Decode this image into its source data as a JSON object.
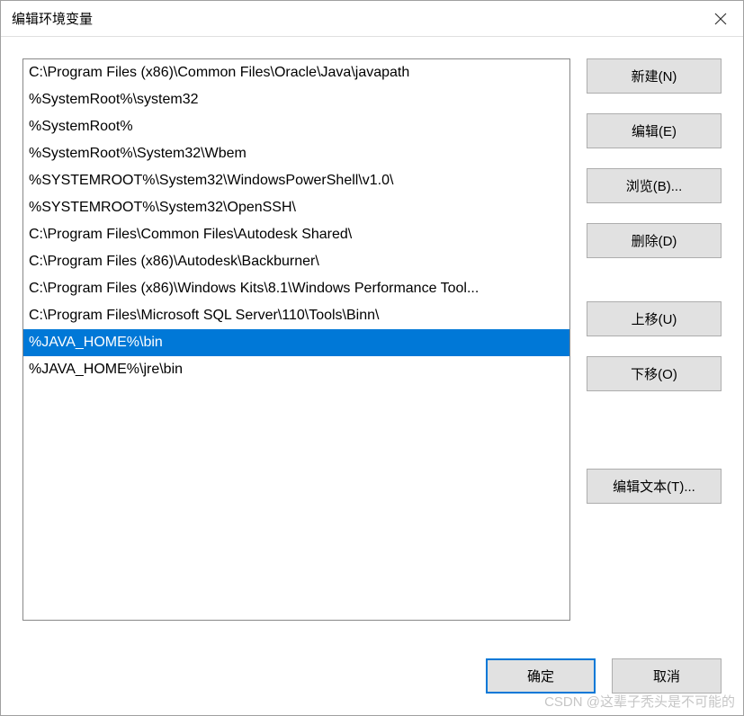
{
  "window": {
    "title": "编辑环境变量"
  },
  "list": {
    "items": [
      "C:\\Program Files (x86)\\Common Files\\Oracle\\Java\\javapath",
      "%SystemRoot%\\system32",
      "%SystemRoot%",
      "%SystemRoot%\\System32\\Wbem",
      "%SYSTEMROOT%\\System32\\WindowsPowerShell\\v1.0\\",
      "%SYSTEMROOT%\\System32\\OpenSSH\\",
      "C:\\Program Files\\Common Files\\Autodesk Shared\\",
      "C:\\Program Files (x86)\\Autodesk\\Backburner\\",
      "C:\\Program Files (x86)\\Windows Kits\\8.1\\Windows Performance Tool...",
      "C:\\Program Files\\Microsoft SQL Server\\110\\Tools\\Binn\\",
      "%JAVA_HOME%\\bin",
      "%JAVA_HOME%\\jre\\bin"
    ],
    "selected_index": 10
  },
  "buttons": {
    "new": "新建(N)",
    "edit": "编辑(E)",
    "browse": "浏览(B)...",
    "delete": "删除(D)",
    "moveup": "上移(U)",
    "movedown": "下移(O)",
    "edittext": "编辑文本(T)...",
    "ok": "确定",
    "cancel": "取消"
  },
  "watermark": "CSDN @这辈子秃头是不可能的"
}
